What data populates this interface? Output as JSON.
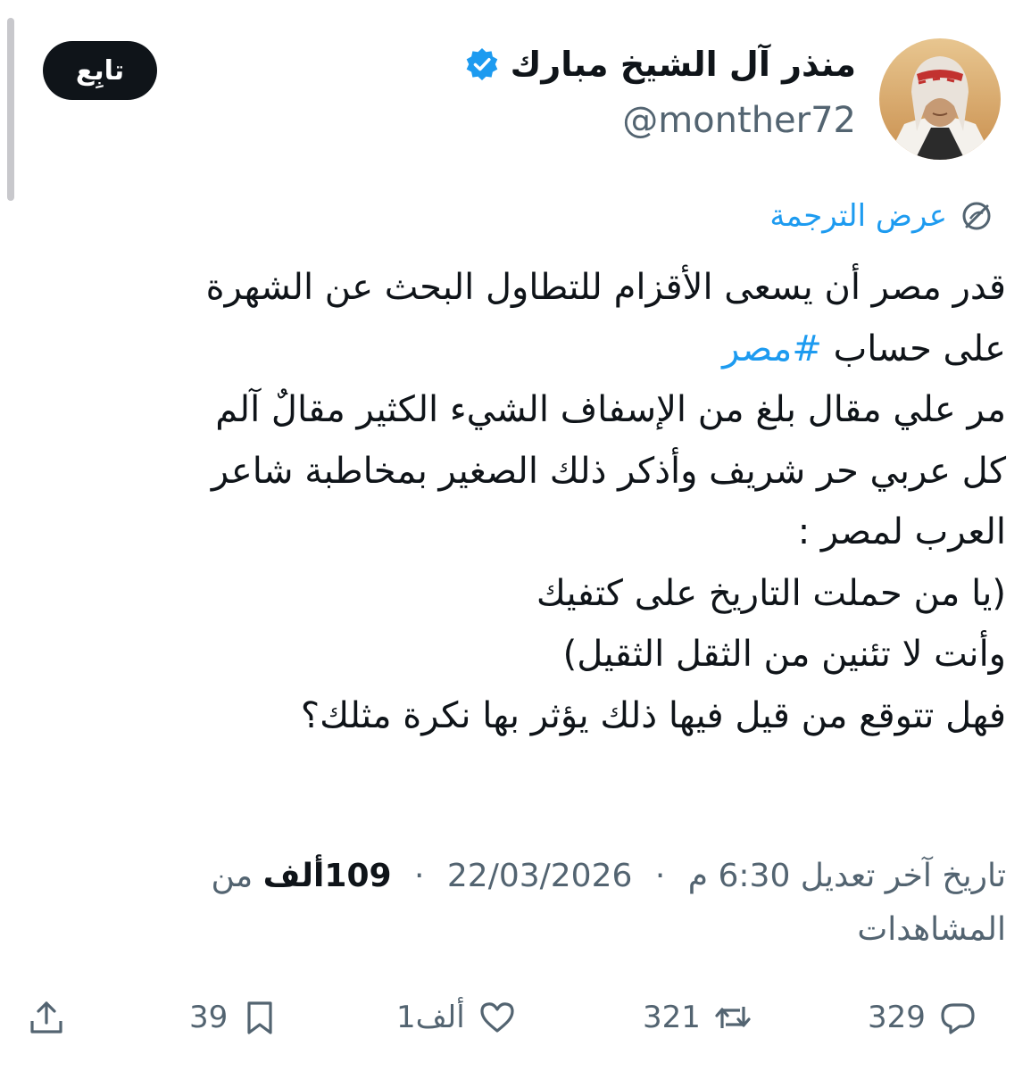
{
  "author": {
    "display_name": "منذر آل الشيخ مبارك",
    "handle": "@monther72",
    "verified": true
  },
  "follow_button": {
    "label": "تابِع"
  },
  "translate": {
    "label": "عرض الترجمة"
  },
  "tweet": {
    "lines": [
      {
        "text": "قدر مصر أن يسعى الأقزام للتطاول البحث عن الشهرة"
      },
      {
        "text": "على حساب ",
        "hashtag": "#مصر"
      },
      {
        "text": "مر علي مقال بلغ من الإسفاف الشيء الكثير مقالٌ آلم"
      },
      {
        "text": "كل عربي حر شريف وأذكر ذلك الصغير بمخاطبة شاعر"
      },
      {
        "text": "العرب لمصر :"
      },
      {
        "text": "(يا من حملت التاريخ على كتفيك"
      },
      {
        "text": "وأنت لا تئنين من الثقل الثقيل)"
      },
      {
        "text": "فهل تتوقع من قيل فيها ذلك يؤثر بها نكرة مثلك؟"
      }
    ]
  },
  "meta": {
    "edited_label": "تاريخ آخر تعديل",
    "time": "6:30 م",
    "separator": "·",
    "date": "22/03/2026",
    "views_count": "109ألف",
    "views_label": "من المشاهدات"
  },
  "actions": {
    "replies": "329",
    "reposts": "321",
    "likes": "1ألف",
    "bookmarks": "39"
  },
  "colors": {
    "accent": "#1d9bf0",
    "text": "#0f1419",
    "secondary": "#536471",
    "follow_bg": "#0f1419"
  }
}
